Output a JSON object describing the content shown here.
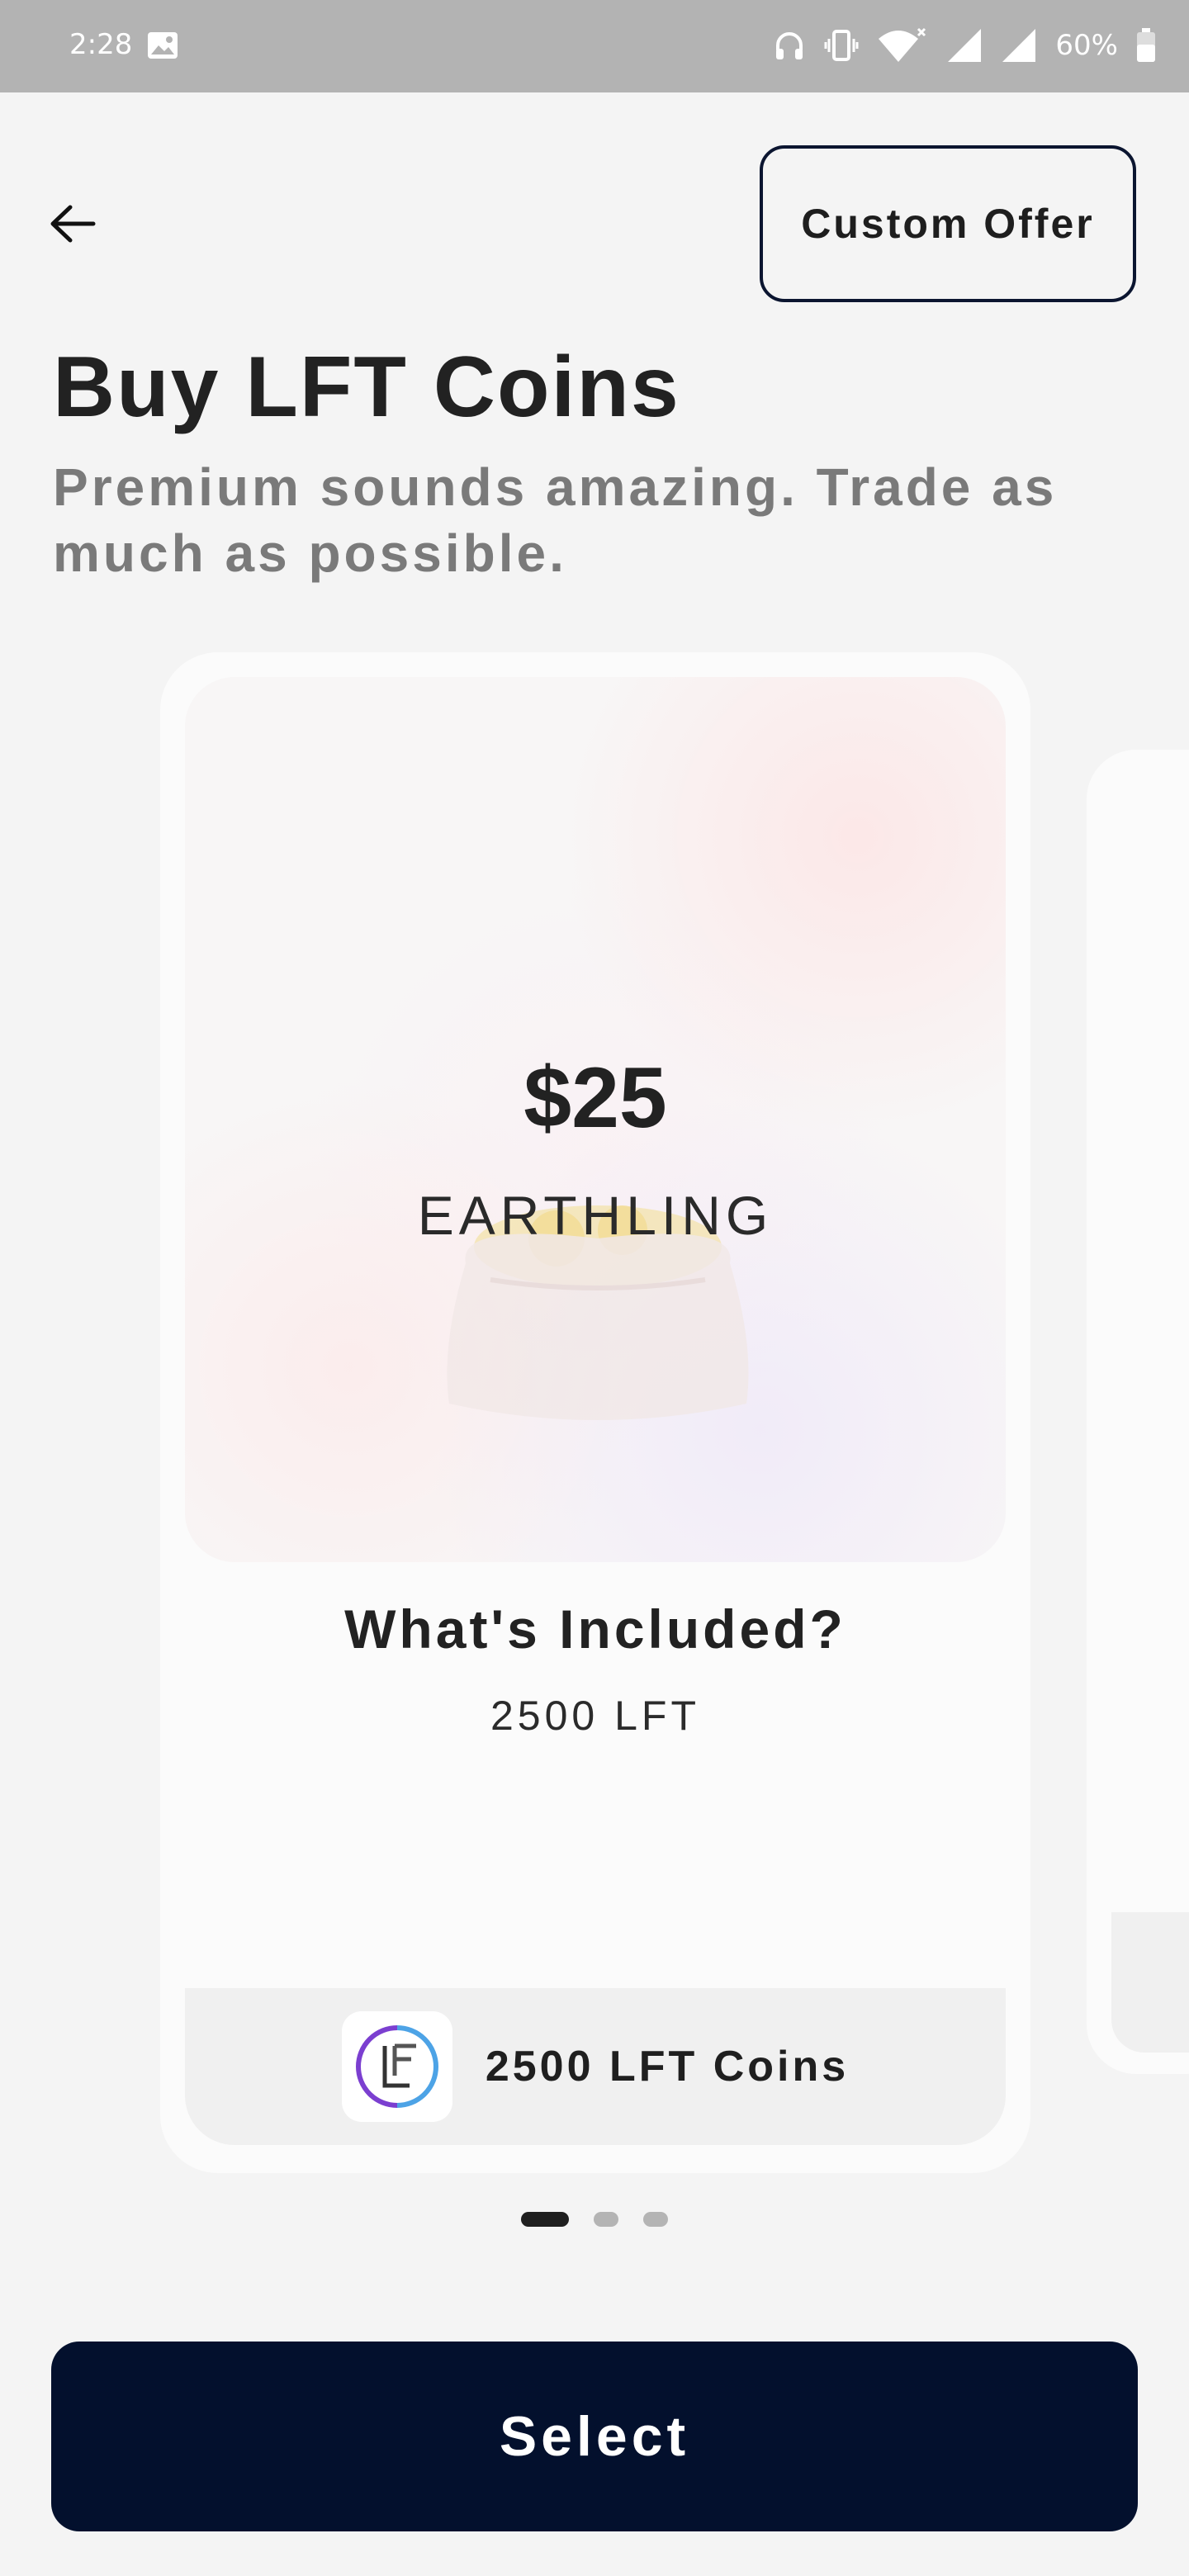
{
  "status_bar": {
    "time": "2:28",
    "battery": "60%",
    "icons": [
      "image-icon",
      "headphones-icon",
      "vibrate-icon",
      "wifi-icon",
      "signal-icon",
      "signal-icon-2",
      "battery-icon"
    ]
  },
  "header": {
    "back_icon": "arrow-left-icon",
    "custom_offer_label": "Custom Offer",
    "title": "Buy LFT Coins",
    "subtitle": "Premium sounds amazing. Trade as much as possible."
  },
  "carousel": {
    "cards": [
      {
        "price": "$25",
        "tier": "EARTHLING",
        "included_heading": "What's Included?",
        "included_items": [
          "2500 LFT"
        ],
        "footer_label": "2500 LFT Coins"
      }
    ],
    "pages": 3,
    "active_page": 0
  },
  "actions": {
    "select_label": "Select"
  },
  "colors": {
    "primary": "#03102d",
    "status_bar": "#b3b3b3",
    "background": "#f4f4f4",
    "card": "#fbfbfb",
    "subtitle": "#7a7a7a",
    "dot_active": "#1f1f1f",
    "dot_inactive": "#b4b4b4"
  }
}
